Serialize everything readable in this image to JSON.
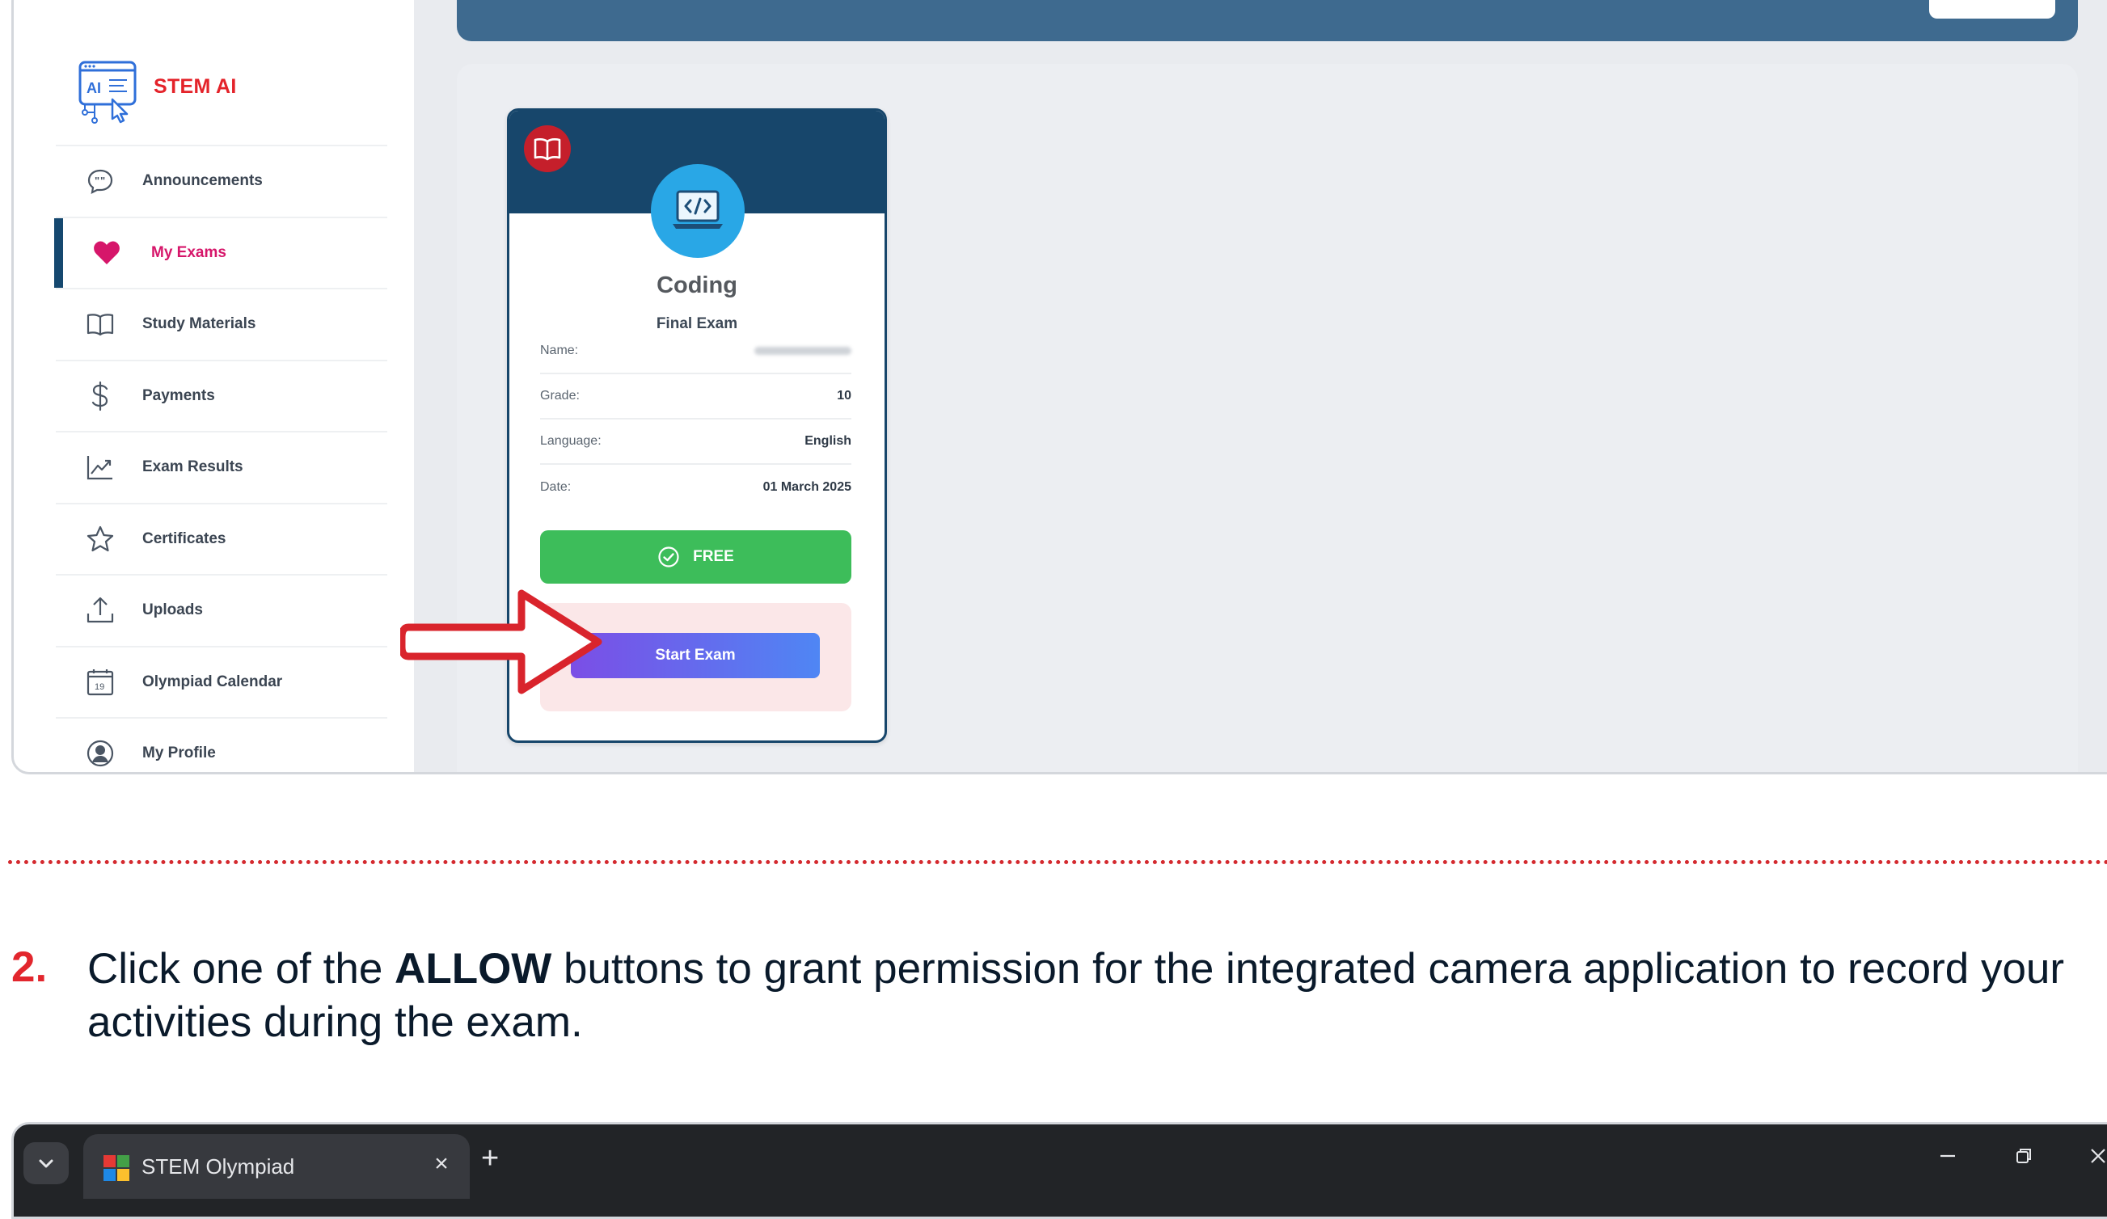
{
  "app": {
    "logo_text": "STEM AI"
  },
  "sidebar": {
    "items": [
      {
        "label": "Announcements",
        "icon": "chat-bubble-icon"
      },
      {
        "label": "My Exams",
        "icon": "heart-icon",
        "active": true
      },
      {
        "label": "Study Materials",
        "icon": "book-icon"
      },
      {
        "label": "Payments",
        "icon": "dollar-icon"
      },
      {
        "label": "Exam Results",
        "icon": "chart-up-icon"
      },
      {
        "label": "Certificates",
        "icon": "star-icon"
      },
      {
        "label": "Uploads",
        "icon": "upload-icon"
      },
      {
        "label": "Olympiad Calendar",
        "icon": "calendar-icon"
      },
      {
        "label": "My Profile",
        "icon": "user-circle-icon"
      }
    ],
    "calendar_day": "19"
  },
  "exam_card": {
    "subject": "Coding",
    "exam_type": "Final Exam",
    "rows": [
      {
        "key": "Name:",
        "value": ""
      },
      {
        "key": "Grade:",
        "value": "10"
      },
      {
        "key": "Language:",
        "value": "English"
      },
      {
        "key": "Date:",
        "value": "01 March 2025"
      }
    ],
    "free_label": "FREE",
    "start_label": "Start Exam"
  },
  "instruction": {
    "number": "2.",
    "text_before": "Click one of the ",
    "text_bold": "ALLOW",
    "text_after": " buttons to grant permission for the integrated camera application to record your activities during the exam."
  },
  "browser": {
    "tab_title": "STEM Olympiad"
  },
  "colors": {
    "accent_red": "#e2262d",
    "navy": "#17466b",
    "active_pink": "#d6166a",
    "free_green": "#3dbd5a"
  }
}
